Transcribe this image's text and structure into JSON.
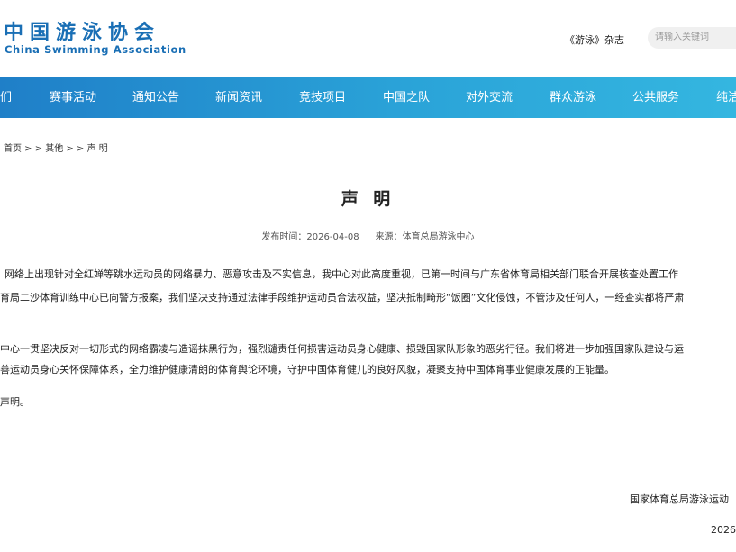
{
  "header": {
    "logo_cn": "中国游泳协会",
    "logo_en": "China Swimming Association",
    "magazine": "《游泳》杂志",
    "search_placeholder": "请输入关键词"
  },
  "nav": {
    "items": [
      "们",
      "赛事活动",
      "通知公告",
      "新闻资讯",
      "竞技项目",
      "中国之队",
      "对外交流",
      "群众游泳",
      "公共服务",
      "纯洁"
    ]
  },
  "breadcrumb": "首页 > > 其他 > > 声 明",
  "article": {
    "title": "声 明",
    "publish_time": "发布时间：2026-04-08",
    "source": "来源：体育总局游泳中心",
    "lines": [
      "网络上出现针对全红婵等跳水运动员的网络暴力、恶意攻击及不实信息，我中心对此高度重视，已第一时间与广东省体育局相关部门联合开展核查处置工作",
      "育局二沙体育训练中心已向警方报案，我们坚决支持通过法律手段维护运动员合法权益，坚决抵制畸形“饭圈”文化侵蚀，不管涉及任何人，一经查实都将严肃",
      "中心一贯坚决反对一切形式的网络霸凌与造谣抹黑行为，强烈谴责任何损害运动员身心健康、损毁国家队形象的恶劣行径。我们将进一步加强国家队建设与运",
      "善运动员身心关怀保障体系，全力维护健康清朗的体育舆论环境，守护中国体育健儿的良好风貌，凝聚支持中国体育事业健康发展的正能量。",
      "声明。"
    ],
    "signature": "国家体育总局游泳运动",
    "date": "2026"
  }
}
